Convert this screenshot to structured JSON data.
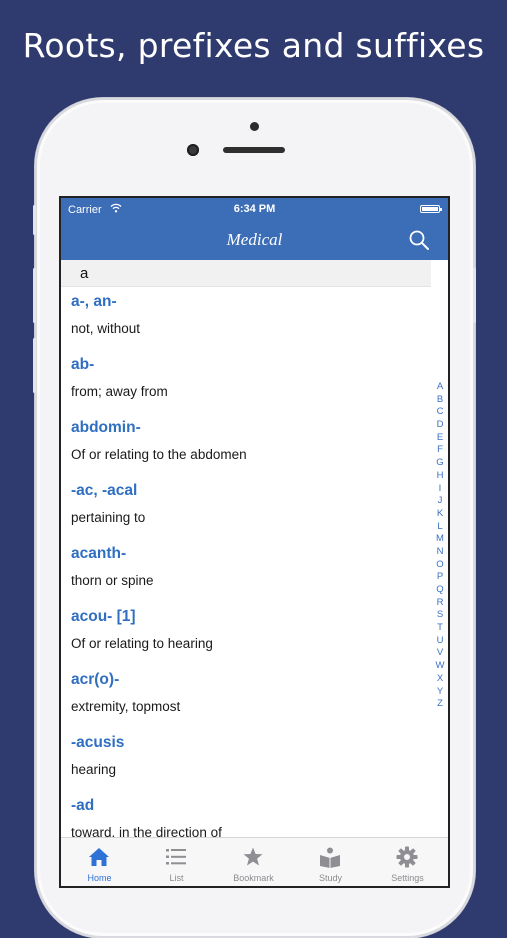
{
  "headline": "Roots, prefixes and suffixes",
  "status": {
    "carrier": "Carrier",
    "time": "6:34 PM"
  },
  "nav": {
    "title": "Medical"
  },
  "section": {
    "letter": "a"
  },
  "entries": [
    {
      "term": "a-, an-",
      "definition": "not, without"
    },
    {
      "term": "ab-",
      "definition": "from; away from"
    },
    {
      "term": "abdomin-",
      "definition": "Of or relating to the abdomen"
    },
    {
      "term": "-ac, -acal",
      "definition": "pertaining to"
    },
    {
      "term": "acanth-",
      "definition": "thorn or spine"
    },
    {
      "term": "acou- [1]",
      "definition": "Of or relating to hearing"
    },
    {
      "term": "acr(o)-",
      "definition": "extremity, topmost"
    },
    {
      "term": "-acusis",
      "definition": "hearing"
    },
    {
      "term": "-ad",
      "definition": "toward, in the direction of"
    }
  ],
  "index_letters": [
    "A",
    "B",
    "C",
    "D",
    "E",
    "F",
    "G",
    "H",
    "I",
    "J",
    "K",
    "L",
    "M",
    "N",
    "O",
    "P",
    "Q",
    "R",
    "S",
    "T",
    "U",
    "V",
    "W",
    "X",
    "Y",
    "Z"
  ],
  "tabs": [
    {
      "label": "Home",
      "icon": "home-icon"
    },
    {
      "label": "List",
      "icon": "list-icon"
    },
    {
      "label": "Bookmark",
      "icon": "star-icon"
    },
    {
      "label": "Study",
      "icon": "study-icon"
    },
    {
      "label": "Settings",
      "icon": "gear-icon"
    }
  ],
  "colors": {
    "background": "#2f3a6e",
    "accent": "#3c6db7",
    "term": "#2f6fc2",
    "active_tab": "#2f72d6"
  }
}
